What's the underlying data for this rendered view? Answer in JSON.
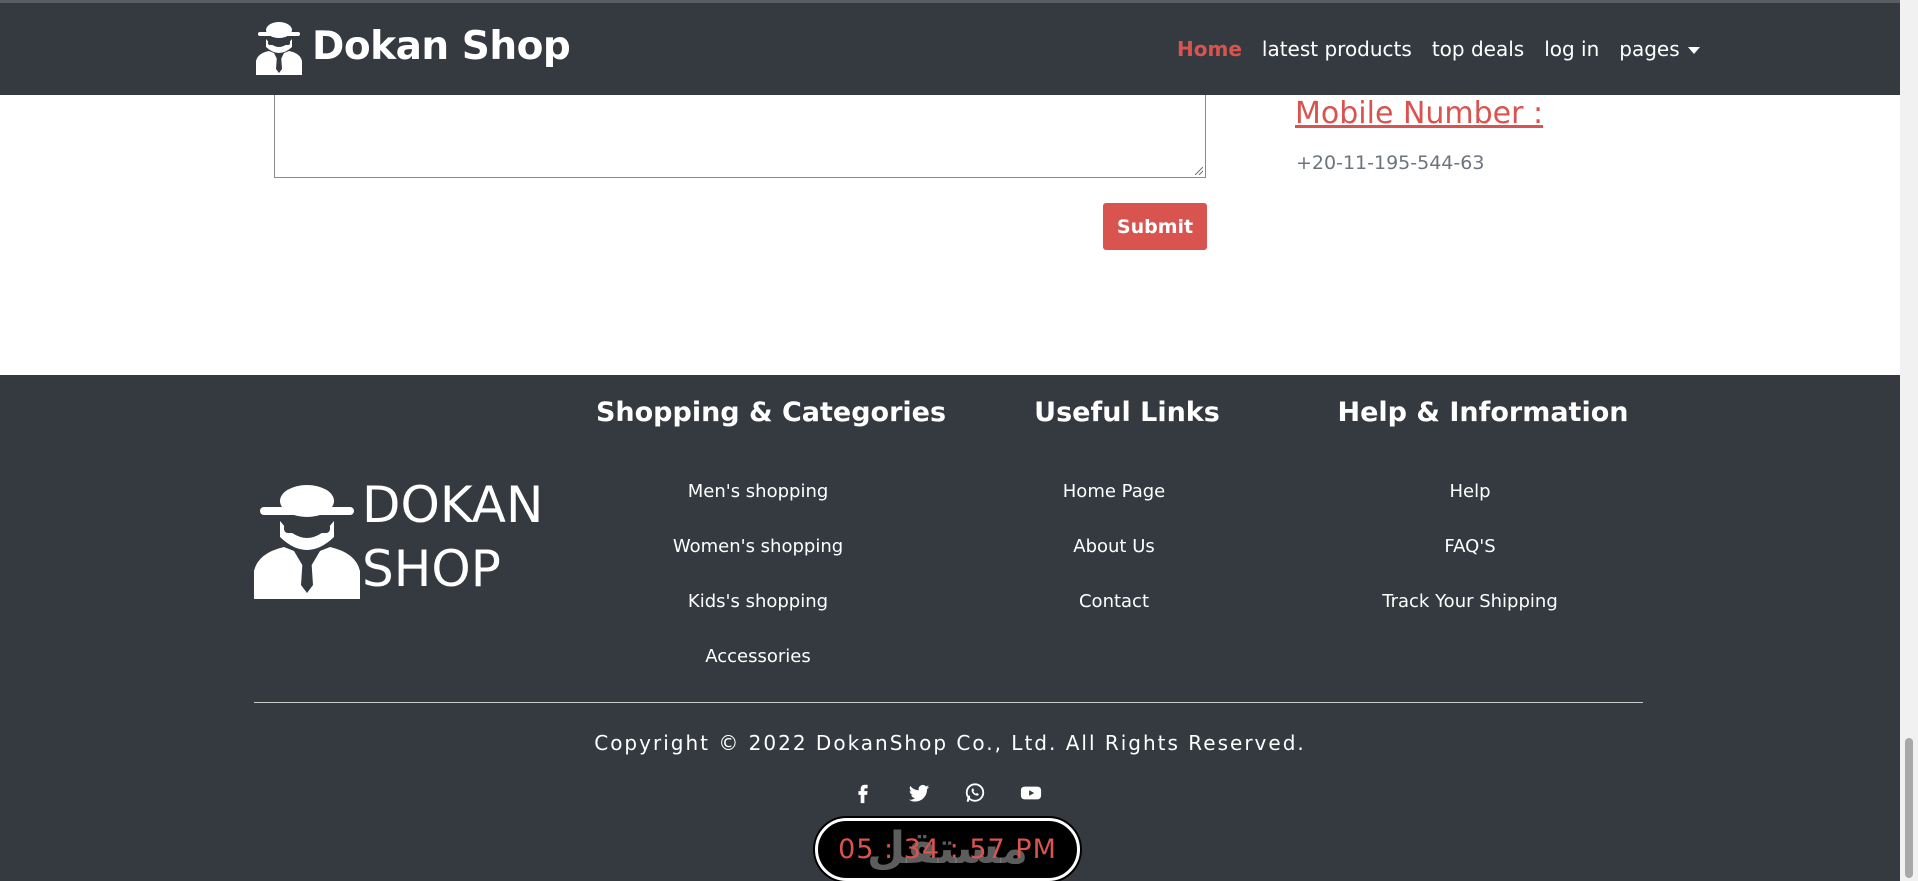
{
  "navbar": {
    "brand": "Dokan Shop",
    "links": [
      {
        "label": "Home",
        "active": true
      },
      {
        "label": "latest products",
        "active": false
      },
      {
        "label": "top deals",
        "active": false
      },
      {
        "label": "log in",
        "active": false
      },
      {
        "label": "pages",
        "active": false,
        "dropdown": true
      }
    ]
  },
  "contact": {
    "message_value": "",
    "submit_label": "Submit",
    "mobile_label": "Mobile Number :",
    "mobile_value": "+20-11-195-544-63"
  },
  "footer": {
    "logo_line1": "DOKAN",
    "logo_line2": "SHOP",
    "columns": [
      {
        "title": "Shopping & Categories",
        "links": [
          "Men's shopping",
          "Women's shopping",
          "Kids's shopping",
          "Accessories"
        ]
      },
      {
        "title": "Useful Links",
        "links": [
          "Home Page",
          "About Us",
          "Contact"
        ]
      },
      {
        "title": "Help & Information",
        "links": [
          "Help",
          "FAQ'S",
          "Track Your Shipping"
        ]
      }
    ],
    "copyright": "Copyright © 2022 DokanShop Co., Ltd. All Rights Reserved.",
    "socials": [
      "facebook-icon",
      "twitter-icon",
      "whatsapp-icon",
      "youtube-icon"
    ]
  },
  "clock": {
    "time": "05 : 34 : 57 PM",
    "watermark": "مستقل"
  },
  "colors": {
    "dark": "#343a40",
    "accent": "#d9534f",
    "muted": "#6c757d"
  }
}
